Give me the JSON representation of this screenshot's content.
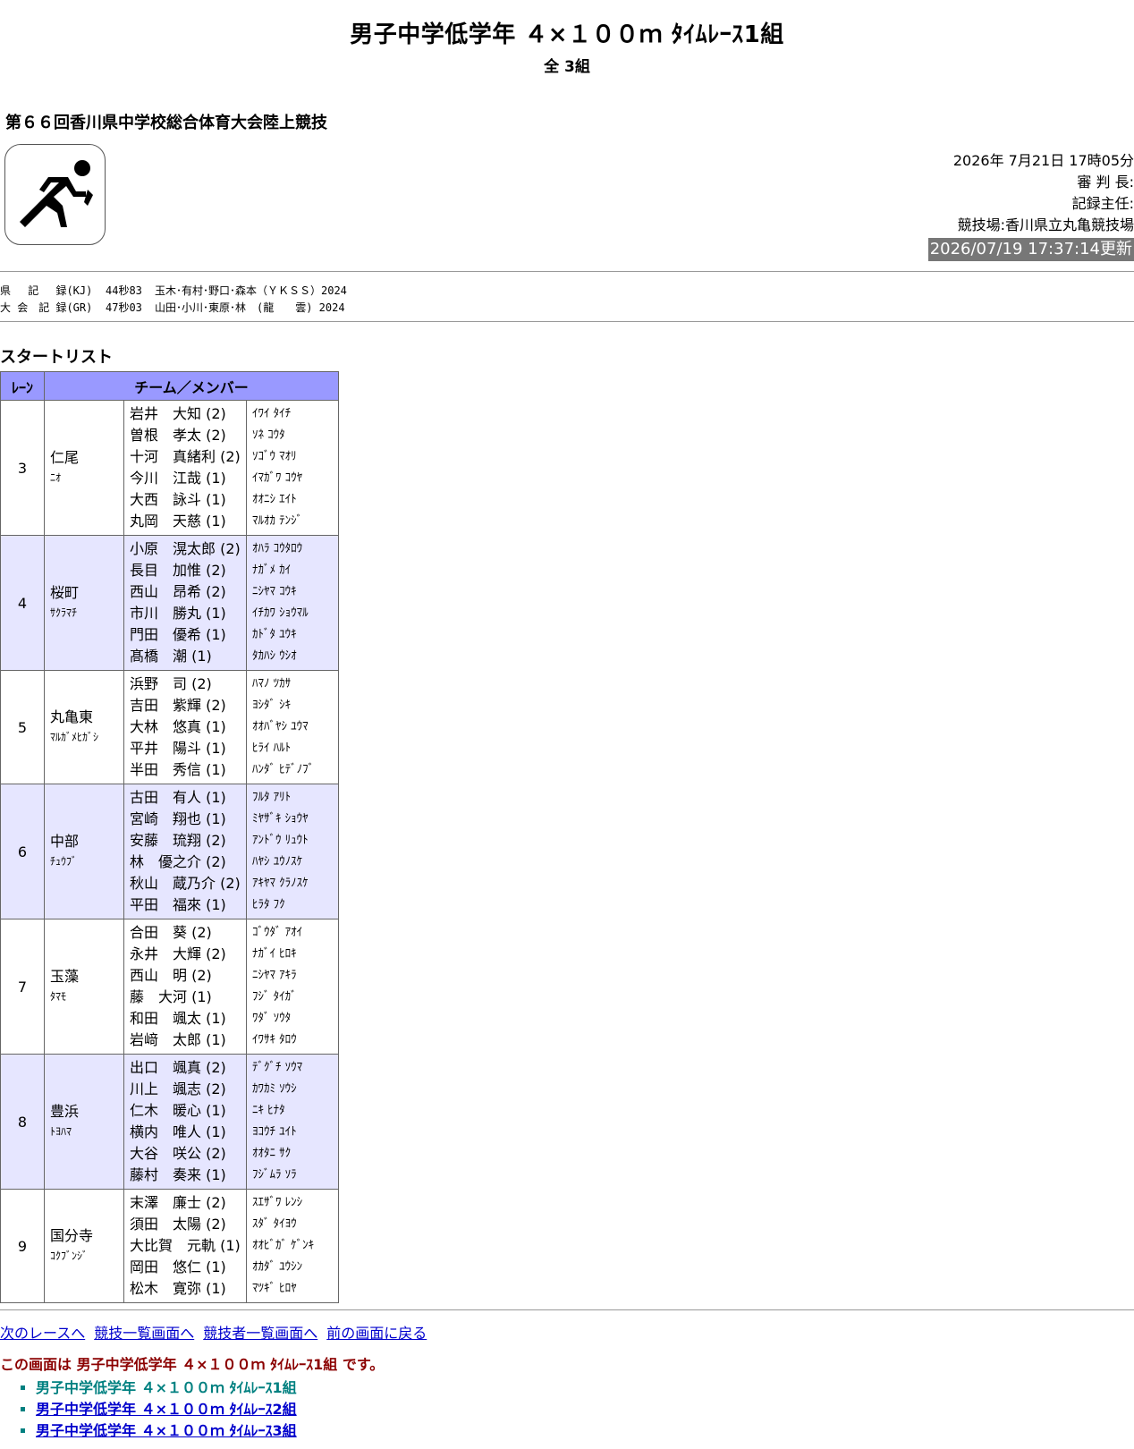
{
  "header": {
    "title": "男子中学低学年 ４×１００ｍ ﾀｲﾑﾚｰｽ1組",
    "subtitle": "全 3組",
    "meet_name": "第６６回香川県中学校総合体育大会陸上競技"
  },
  "logo": {
    "icon": "runner-icon"
  },
  "info": {
    "datetime": "2026年 7月21日 17時05分",
    "referee": "審 判 長:",
    "recorder": "記録主任:",
    "venue": "競技場:香川県立丸亀競技場",
    "updated": "2026/07/19 17:37:14更新"
  },
  "records": [
    {
      "label": "県　 記　 録(KJ)",
      "time": "44秒83",
      "names": "玉木･有村･野口･森本（ＹＫＳＳ）2024"
    },
    {
      "label": "大 会　記 録(GR)",
      "time": "47秒03",
      "names": "山田･小川･東原･林　(龍　　雲) 2024"
    }
  ],
  "start_list": {
    "heading": "スタートリスト",
    "col_lane": "ﾚｰﾝ",
    "col_team": "チーム／メンバー",
    "teams": [
      {
        "lane": "3",
        "name": "仁尾",
        "kana": "ﾆｵ",
        "members": [
          "岩井　大知 (2)",
          "曽根　孝太 (2)",
          "十河　真緒利 (2)",
          "今川　江哉 (1)",
          "大西　詠斗 (1)",
          "丸岡　天慈 (1)"
        ],
        "member_kana": [
          "ｲﾜｲ ﾀｲﾁ",
          "ｿﾈ ｺｳﾀ",
          "ｿｺﾞｳ ﾏｵﾘ",
          "ｲﾏｶﾞﾜ ｺｳﾔ",
          "ｵｵﾆｼ ｴｲﾄ",
          "ﾏﾙｵｶ ﾃﾝｼﾞ"
        ]
      },
      {
        "lane": "4",
        "name": "桜町",
        "kana": "ｻｸﾗﾏﾁ",
        "members": [
          "小原　滉太郎 (2)",
          "長目　加惟 (2)",
          "西山　昂希 (2)",
          "市川　勝丸 (1)",
          "門田　優希 (1)",
          "髙橋　潮 (1)"
        ],
        "member_kana": [
          "ｵﾊﾗ ｺｳﾀﾛｳ",
          "ﾅｶﾞﾒ ｶｲ",
          "ﾆｼﾔﾏ ｺｳｷ",
          "ｲﾁｶﾜ ｼｮｳﾏﾙ",
          "ｶﾄﾞﾀ ﾕｳｷ",
          "ﾀｶﾊｼ ｳｼｵ"
        ]
      },
      {
        "lane": "5",
        "name": "丸亀東",
        "kana": "ﾏﾙｶﾞﾒﾋｶﾞｼ",
        "members": [
          "浜野　司 (2)",
          "吉田　紫輝 (2)",
          "大林　悠真 (1)",
          "平井　陽斗 (1)",
          "半田　秀信 (1)"
        ],
        "member_kana": [
          "ﾊﾏﾉ ﾂｶｻ",
          "ﾖｼﾀﾞ ｼｷ",
          "ｵｵﾊﾞﾔｼ ﾕｳﾏ",
          "ﾋﾗｲ ﾊﾙﾄ",
          "ﾊﾝﾀﾞ ﾋﾃﾞﾉﾌﾞ"
        ]
      },
      {
        "lane": "6",
        "name": "中部",
        "kana": "ﾁｭｳﾌﾞ",
        "members": [
          "古田　有人 (1)",
          "宮崎　翔也 (1)",
          "安藤　琉翔 (2)",
          "林　優之介 (2)",
          "秋山　蔵乃介 (2)",
          "平田　福來 (1)"
        ],
        "member_kana": [
          "ﾌﾙﾀ ｱﾘﾄ",
          "ﾐﾔｻﾞｷ ｼｮｳﾔ",
          "ｱﾝﾄﾞｳ ﾘｭｳﾄ",
          "ﾊﾔｼ ﾕｳﾉｽｹ",
          "ｱｷﾔﾏ ｸﾗﾉｽｹ",
          "ﾋﾗﾀ ﾌｸ"
        ]
      },
      {
        "lane": "7",
        "name": "玉藻",
        "kana": "ﾀﾏﾓ",
        "members": [
          "合田　葵 (2)",
          "永井　大輝 (2)",
          "西山　明 (2)",
          "藤　大河 (1)",
          "和田　颯太 (1)",
          "岩﨑　太郎 (1)"
        ],
        "member_kana": [
          "ｺﾞｳﾀﾞ ｱｵｲ",
          "ﾅｶﾞｲ ﾋﾛｷ",
          "ﾆｼﾔﾏ ｱｷﾗ",
          "ﾌｼﾞ ﾀｲｶﾞ",
          "ﾜﾀﾞ ｿｳﾀ",
          "ｲﾜｻｷ ﾀﾛｳ"
        ]
      },
      {
        "lane": "8",
        "name": "豊浜",
        "kana": "ﾄﾖﾊﾏ",
        "members": [
          "出口　颯真 (2)",
          "川上　颯志 (2)",
          "仁木　暖心 (1)",
          "横内　唯人 (1)",
          "大谷　咲公 (2)",
          "藤村　奏来 (1)"
        ],
        "member_kana": [
          "ﾃﾞｸﾞﾁ ｿｳﾏ",
          "ｶﾜｶﾐ ｿｳｼ",
          "ﾆｷ ﾋﾅﾀ",
          "ﾖｺｳﾁ ﾕｲﾄ",
          "ｵｵﾀﾆ ｻｸ",
          "ﾌｼﾞﾑﾗ ｿﾗ"
        ]
      },
      {
        "lane": "9",
        "name": "国分寺",
        "kana": "ｺｸﾌﾞﾝｼﾞ",
        "members": [
          "末澤　廉士 (2)",
          "須田　太陽 (2)",
          "大比賀　元軌 (1)",
          "岡田　悠仁 (1)",
          "松木　寛弥 (1)"
        ],
        "member_kana": [
          "ｽｴｻﾞﾜ ﾚﾝｼ",
          "ｽﾀﾞ ﾀｲﾖｳ",
          "ｵｵﾋﾞｶﾞ ｹﾞﾝｷ",
          "ｵｶﾀﾞ ﾕｳｼﾝ",
          "ﾏﾂｷﾞ ﾋﾛﾔ"
        ]
      }
    ]
  },
  "nav_links": [
    "次のレースへ",
    "競技一覧画面へ",
    "競技者一覧画面へ",
    "前の画面に戻る"
  ],
  "current_note": "この画面は 男子中学低学年 ４×１００ｍ ﾀｲﾑﾚｰｽ1組 です。",
  "heats": [
    {
      "label": "男子中学低学年 ４×１００ｍ ﾀｲﾑﾚｰｽ1組",
      "current": true
    },
    {
      "label": "男子中学低学年 ４×１００ｍ ﾀｲﾑﾚｰｽ2組",
      "current": false
    },
    {
      "label": "男子中学低学年 ４×１００ｍ ﾀｲﾑﾚｰｽ3組",
      "current": false
    }
  ]
}
